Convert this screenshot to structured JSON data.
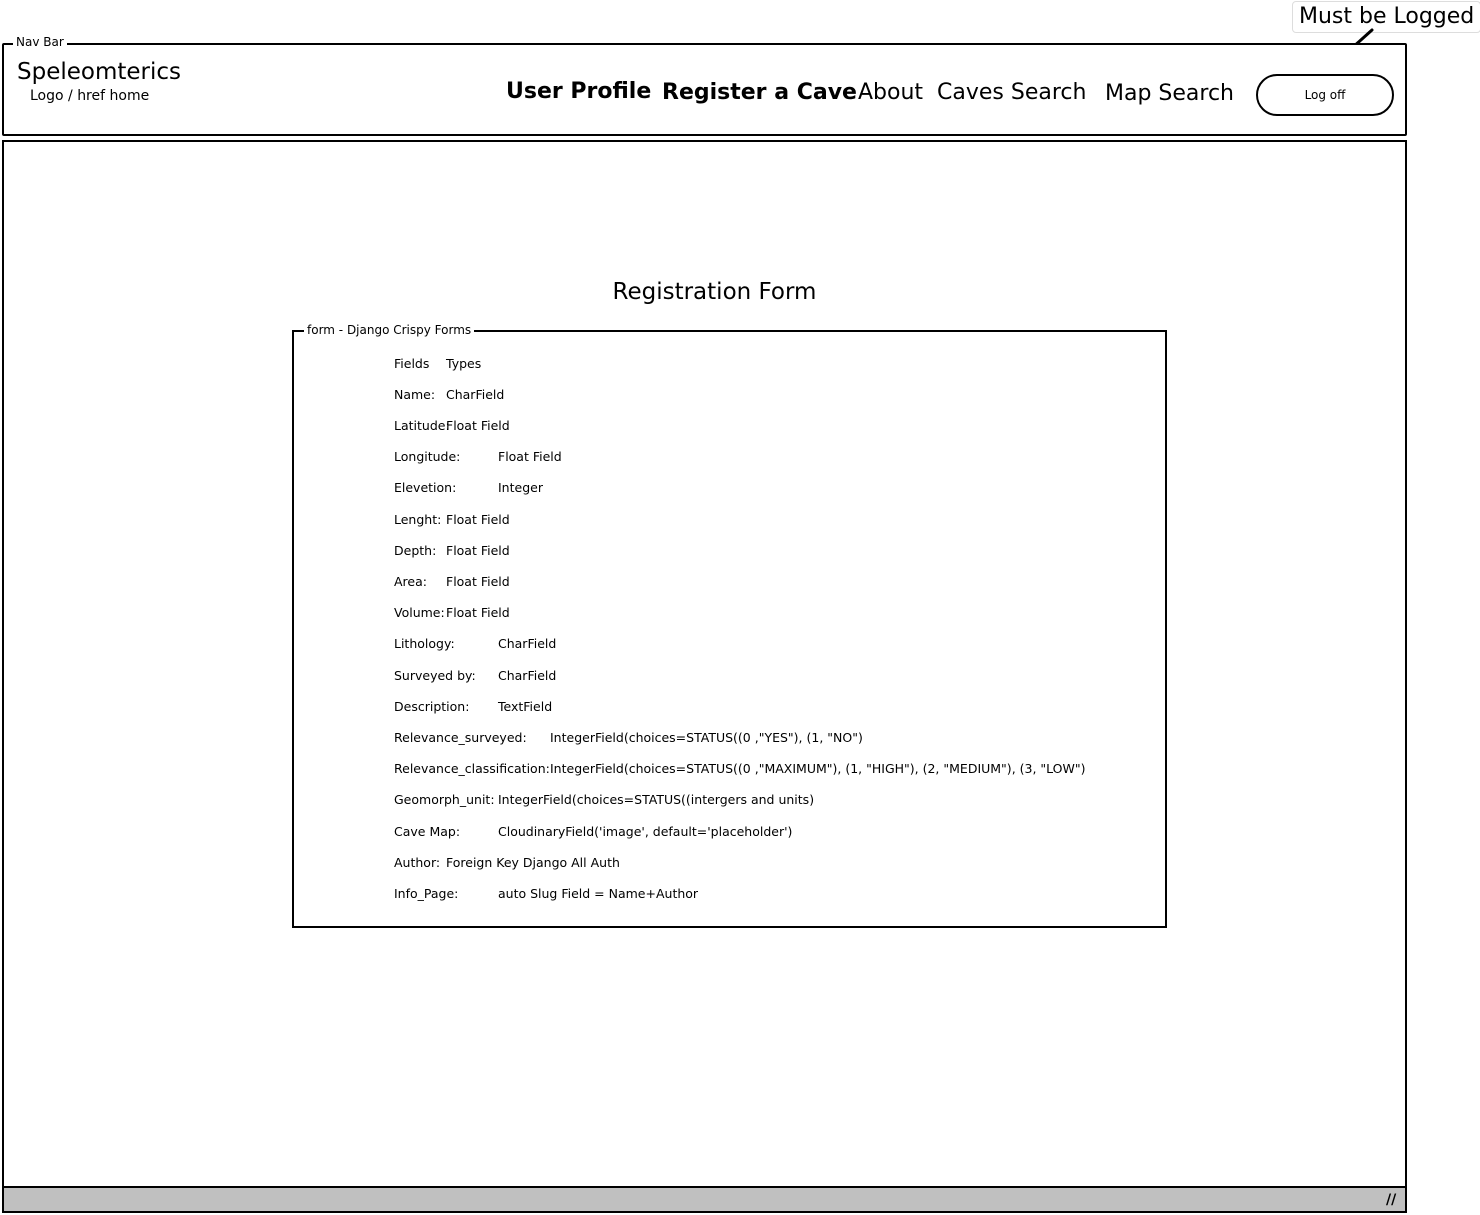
{
  "annotation": {
    "text": "Must be Logged"
  },
  "navbar": {
    "caption": "Nav Bar",
    "brand_title": "Speleomterics",
    "brand_subtitle": "Logo / href home",
    "links": {
      "user_profile": "User Profile",
      "register_cave": "Register a Cave",
      "about": "About",
      "caves_search": "Caves Search",
      "map_search": "Map Search"
    },
    "logoff_label": "Log off"
  },
  "main": {
    "title": "Registration Form",
    "form_caption": "form - Django Crispy Forms",
    "rows": [
      {
        "field": "Fields",
        "type": "Types"
      },
      {
        "field": "Name:",
        "type": "CharField"
      },
      {
        "field": "Latitude:",
        "type": "Float Field"
      },
      {
        "field": "Longitude:",
        "type": "Float Field"
      },
      {
        "field": "Elevetion:",
        "type": "Integer"
      },
      {
        "field": "Lenght:",
        "type": "Float Field"
      },
      {
        "field": "Depth:",
        "type": "Float Field"
      },
      {
        "field": "Area:",
        "type": "Float Field"
      },
      {
        "field": "Volume:",
        "type": "Float Field"
      },
      {
        "field": "Lithology:",
        "type": "CharField"
      },
      {
        "field": "Surveyed by:",
        "type": "CharField"
      },
      {
        "field": "Description:",
        "type": "TextField"
      },
      {
        "field": "Relevance_surveyed:",
        "type": "IntegerField(choices=STATUS((0 ,\"YES\"), (1, \"NO\")"
      },
      {
        "field": "Relevance_classification:",
        "type": "IntegerField(choices=STATUS((0 ,\"MAXIMUM\"), (1, \"HIGH\"), (2, \"MEDIUM\"), (3, \"LOW\")"
      },
      {
        "field": "Geomorph_unit:",
        "type": "IntegerField(choices=STATUS((intergers and units)"
      },
      {
        "field": "Cave Map:",
        "type": "CloudinaryField('image', default='placeholder')"
      },
      {
        "field": "Author:",
        "type": "Foreign Key Django All Auth"
      },
      {
        "field": "Info_Page:",
        "type": "auto Slug Field = Name+Author"
      }
    ]
  }
}
